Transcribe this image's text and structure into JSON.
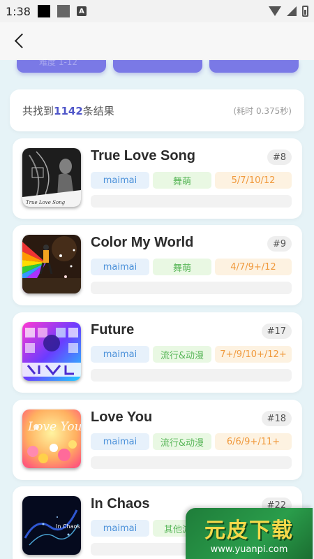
{
  "status": {
    "time": "1:38",
    "badge": "A"
  },
  "summary": {
    "prefix": "共找到",
    "count": "1142",
    "suffix": "条结果",
    "elapsed": "(耗时 0.375秒)"
  },
  "filter_buttons": [
    {
      "label": "难度 1-12"
    }
  ],
  "songs": [
    {
      "title": "True Love Song",
      "rank": "#8",
      "platform": "maimai",
      "genre": "舞萌",
      "levels": "5/7/10/12"
    },
    {
      "title": "Color My World",
      "rank": "#9",
      "platform": "maimai",
      "genre": "舞萌",
      "levels": "4/7/9+/12"
    },
    {
      "title": "Future",
      "rank": "#17",
      "platform": "maimai",
      "genre": "流行&动漫",
      "levels": "7+/9/10+/12+"
    },
    {
      "title": "Love You",
      "rank": "#18",
      "platform": "maimai",
      "genre": "流行&动漫",
      "levels": "6/6/9+/11+"
    },
    {
      "title": "In Chaos",
      "rank": "#22",
      "platform": "maimai",
      "genre": "其他游戏",
      "levels": ""
    }
  ],
  "cover_texts": [
    "True Love Song",
    "Love You",
    "In Chaos"
  ],
  "watermark": {
    "title": "元皮下载",
    "url": "www.yuanpi.com"
  },
  "colors": {
    "accent": "#4f56c9",
    "filter_button": "#7a79e6",
    "platform_tag": "#4a90d9",
    "genre_tag": "#5cb85c",
    "levels_tag": "#f0993c"
  }
}
